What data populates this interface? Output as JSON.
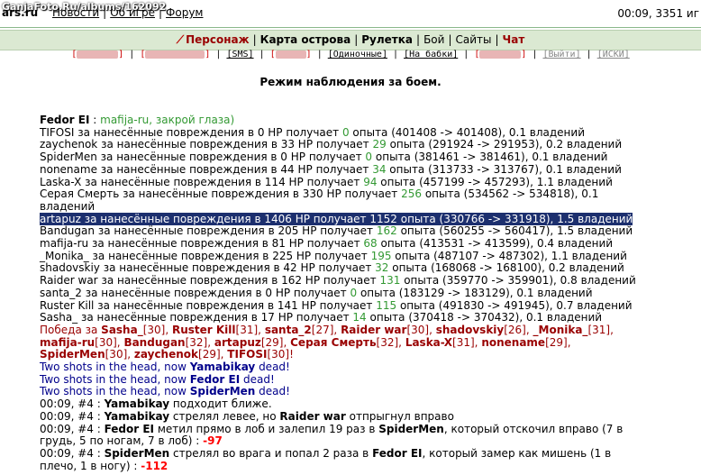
{
  "watermark": "GanjaFoto.Ru/albums/162092",
  "site_logo": "ars.ru",
  "topnav": {
    "news": "Новости",
    "about": "Об игре",
    "forum": "Форум"
  },
  "clock": "00:09, 3351 иг",
  "menu": {
    "character": "Персонаж",
    "island_map": "Карта острова",
    "roulette": "Рулетка",
    "fight": "Бой",
    "sites": "Сайты",
    "chat": "Чат"
  },
  "submenu": {
    "sms": "[SMS]",
    "single": "[Одиночные]",
    "money": "[На бабки]",
    "exit": "[Выйти]",
    "search": "[ИСКИ]"
  },
  "mode_title": "Режим наблюдения за боем.",
  "header": {
    "name": "Fedor EI",
    "sep": " : ",
    "msg": "mafija-ru, закрой глаза)"
  },
  "exp_lines": [
    {
      "name": "TIFOSI",
      "hp": "0",
      "exp": "0",
      "range": "(401408 -> 401408)",
      "own": "0.1"
    },
    {
      "name": "zaychenok",
      "hp": "33",
      "exp": "29",
      "range": "(291924 -> 291953)",
      "own": "0.2"
    },
    {
      "name": "SpiderMen",
      "hp": "0",
      "exp": "0",
      "range": "(381461 -> 381461)",
      "own": "0.1"
    },
    {
      "name": "nonename",
      "hp": "44",
      "exp": "34",
      "range": "(313733 -> 313767)",
      "own": "0.1"
    },
    {
      "name": "Laska-X",
      "hp": "114",
      "exp": "94",
      "range": "(457199 -> 457293)",
      "own": "1.1"
    },
    {
      "name": "Серая Смерть",
      "hp": "330",
      "exp": "256",
      "range": "(534562 -> 534818)",
      "own": "0.1"
    },
    {
      "name": "artapuz",
      "hp": "1406",
      "exp": "1152",
      "range": "(330766 -> 331918)",
      "own": "1.5"
    },
    {
      "name": "Bandugan",
      "hp": "205",
      "exp": "162",
      "range": "(560255 -> 560417)",
      "own": "1.5"
    },
    {
      "name": "mafija-ru",
      "hp": "81",
      "exp": "68",
      "range": "(413531 -> 413599)",
      "own": "0.4"
    },
    {
      "name": "_Monika_",
      "hp": "225",
      "exp": "195",
      "range": "(487107 -> 487302)",
      "own": "1.1"
    },
    {
      "name": "shadovskiy",
      "hp": "42",
      "exp": "32",
      "range": "(168068 -> 168100)",
      "own": "0.2"
    },
    {
      "name": "Raider war",
      "hp": "162",
      "exp": "131",
      "range": "(359770 -> 359901)",
      "own": "0.8"
    },
    {
      "name": "santa_2",
      "hp": "0",
      "exp": "0",
      "range": "(183129 -> 183129)",
      "own": "0.1"
    },
    {
      "name": "Ruster Kill",
      "hp": "141",
      "exp": "115",
      "range": "(491830 -> 491945)",
      "own": "0.7"
    },
    {
      "name": "Sasha_",
      "hp": "17",
      "exp": "14",
      "range": "(370418 -> 370432)",
      "own": "0.1"
    }
  ],
  "phrases": {
    "dmg_for": " за нанесённые повреждения в ",
    "hp_gets": " HP получает ",
    "exp": " опыта ",
    "own_suffix": " владений"
  },
  "victory": {
    "prefix": "Победа за ",
    "winners": [
      {
        "name": "Sasha_",
        "lvl": "[30]"
      },
      {
        "name": "Ruster Kill",
        "lvl": "[31]"
      },
      {
        "name": "santa_2",
        "lvl": "[27]"
      },
      {
        "name": "Raider war",
        "lvl": "[30]"
      },
      {
        "name": "shadovskiy",
        "lvl": "[26]"
      },
      {
        "name": "_Monika_",
        "lvl": "[31]"
      },
      {
        "name": "mafija-ru",
        "lvl": "[30]"
      },
      {
        "name": "Bandugan",
        "lvl": "[32]"
      },
      {
        "name": "artapuz",
        "lvl": "[29]"
      },
      {
        "name": "Серая Смерть",
        "lvl": "[32]"
      },
      {
        "name": "Laska-X",
        "lvl": "[31]"
      },
      {
        "name": "nonename",
        "lvl": "[29]"
      },
      {
        "name": "SpiderMen",
        "lvl": "[30]"
      },
      {
        "name": "zaychenok",
        "lvl": "[29]"
      },
      {
        "name": "TIFOSI",
        "lvl": "[30]"
      }
    ],
    "end": "!"
  },
  "shots": [
    {
      "text": "Two shots in the head, now ",
      "name": "Yamabikay",
      "end": " dead!"
    },
    {
      "text": "Two shots in the head, now ",
      "name": "Fedor EI",
      "end": " dead!"
    },
    {
      "text": "Two shots in the head, now ",
      "name": "SpiderMen",
      "end": " dead!"
    }
  ],
  "events": {
    "e1": {
      "time": "00:09, #4 : ",
      "name": "Yamabikay",
      "text": " подходит ближе."
    },
    "e2": {
      "time": "00:09, #4 : ",
      "name": "Yamabikay",
      "text": " стрелял левее, но ",
      "name2": "Raider war",
      "text2": " отпрыгнул вправо"
    },
    "e3": {
      "time": "00:09, #4 : ",
      "name": "Fedor EI",
      "text": " метил прямо в лоб и залепил 19 раз в ",
      "name2": "SpiderMen",
      "text2": ", который отскочил вправо (7 в грудь, 5 по ногам, 7 в лоб) : ",
      "dmg": "-97"
    },
    "e4": {
      "time": "00:09, #4 : ",
      "name": "SpiderMen",
      "text": " стрелял во врага и попал 2 раза в ",
      "name2": "Fedor EI",
      "text2": ", который замер как мишень (1 в плечо, 1 в ногу) : ",
      "dmg": "-112"
    }
  },
  "colors": {
    "menu_bg": "#dbe9d2",
    "exp_green": "#339933",
    "player_red": "#990000",
    "team_blue": "#00008b",
    "damage": "#ff0000",
    "selection": "#1c2f6e"
  }
}
